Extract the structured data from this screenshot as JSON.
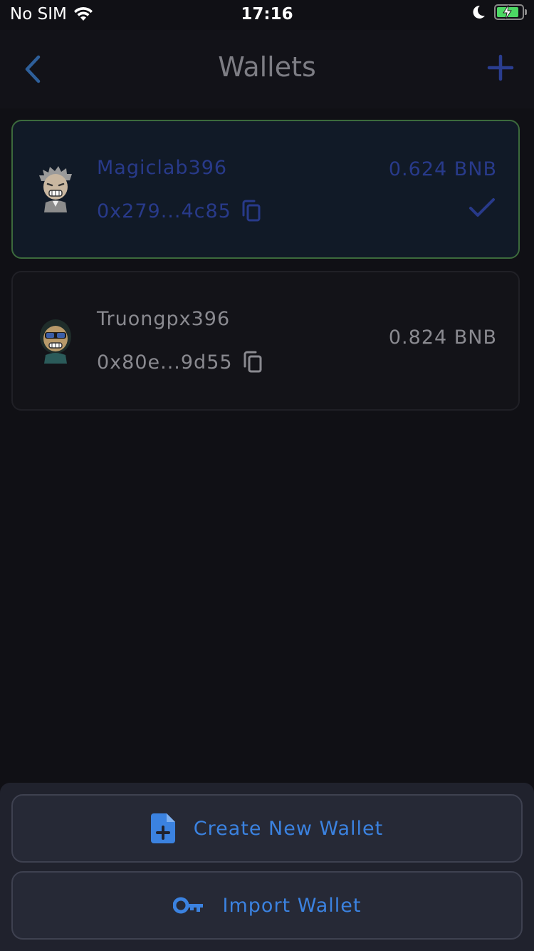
{
  "status_bar": {
    "carrier": "No SIM",
    "time": "17:16"
  },
  "nav": {
    "title": "Wallets",
    "back_icon": "chevron-left-icon",
    "add_icon": "plus-icon"
  },
  "wallets": [
    {
      "name": "Magiclab396",
      "address": "0x279...4c85",
      "balance": "0.624 BNB",
      "selected": true
    },
    {
      "name": "Truongpx396",
      "address": "0x80e...9d55",
      "balance": "0.824 BNB",
      "selected": false
    }
  ],
  "actions": {
    "create_label": "Create New Wallet",
    "import_label": "Import Wallet"
  },
  "colors": {
    "accent": "#3b82e0",
    "background": "#101015",
    "selected_border": "#3c6a3c",
    "battery": "#4cd964"
  }
}
